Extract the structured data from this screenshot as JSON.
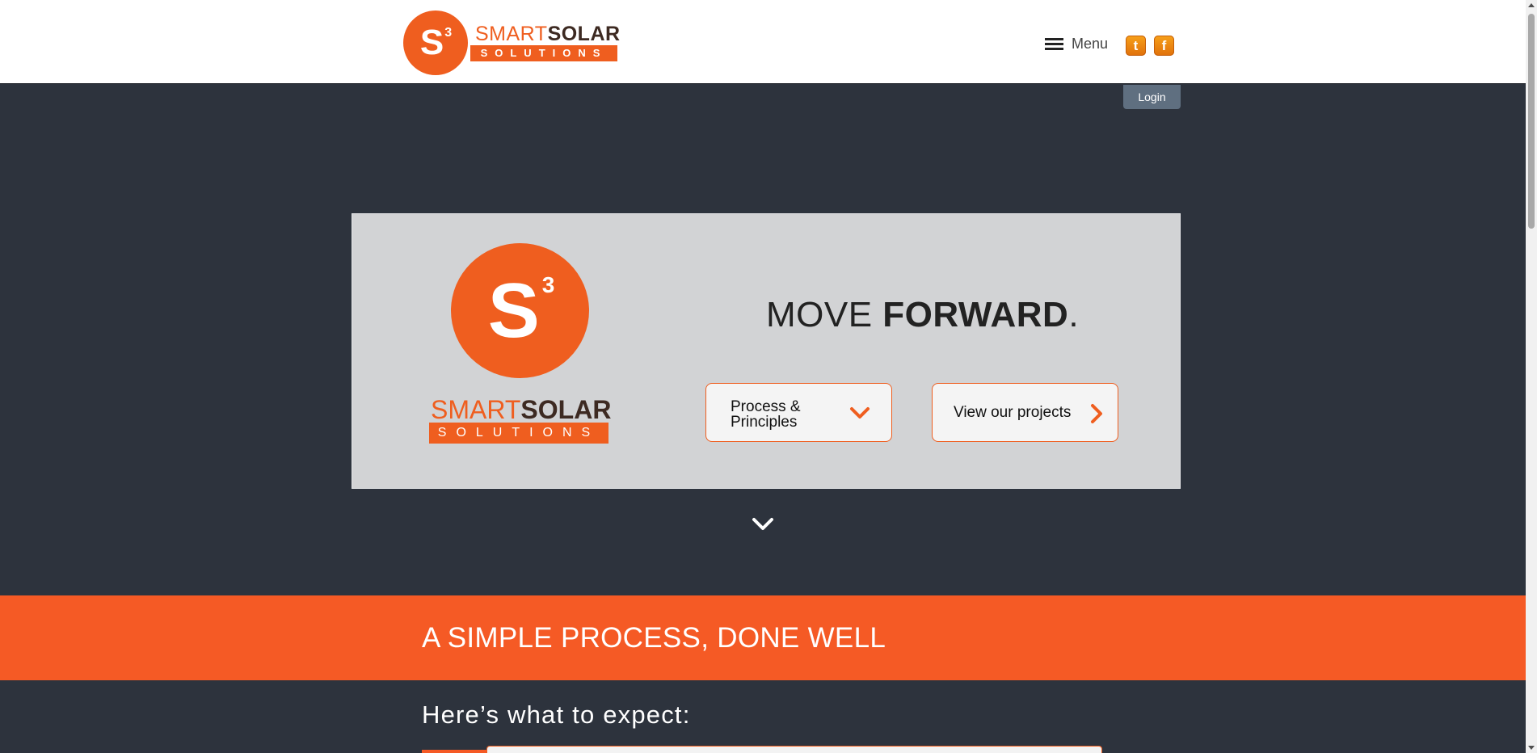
{
  "header": {
    "logo": {
      "mark_letter": "S",
      "mark_superscript": "3",
      "word_light": "SMART",
      "word_bold": "SOLAR",
      "subword": "SOLUTIONS"
    },
    "menu_label": "Menu",
    "social": {
      "twitter_glyph": "t",
      "facebook_glyph": "f"
    },
    "login_label": "Login"
  },
  "hero": {
    "logo": {
      "mark_letter": "S",
      "mark_superscript": "3",
      "word_light": "SMART",
      "word_bold": "SOLAR",
      "subword": "SOLUTIONS"
    },
    "tagline_light": "MOVE ",
    "tagline_bold": "FORWARD",
    "tagline_end": ".",
    "buttons": [
      {
        "label": "Process & Principles",
        "icon": "chevron-down-icon"
      },
      {
        "label": "View our projects",
        "icon": "chevron-right-icon"
      }
    ]
  },
  "section": {
    "title": "A SIMPLE PROCESS, DONE WELL",
    "subtitle": "Here’s what to expect:"
  },
  "colors": {
    "brand_orange": "#ef5e1f",
    "band_orange": "#f55a25",
    "page_background": "#2d333d",
    "hero_panel": "#d2d3d5",
    "login_button": "#5f6f80"
  }
}
